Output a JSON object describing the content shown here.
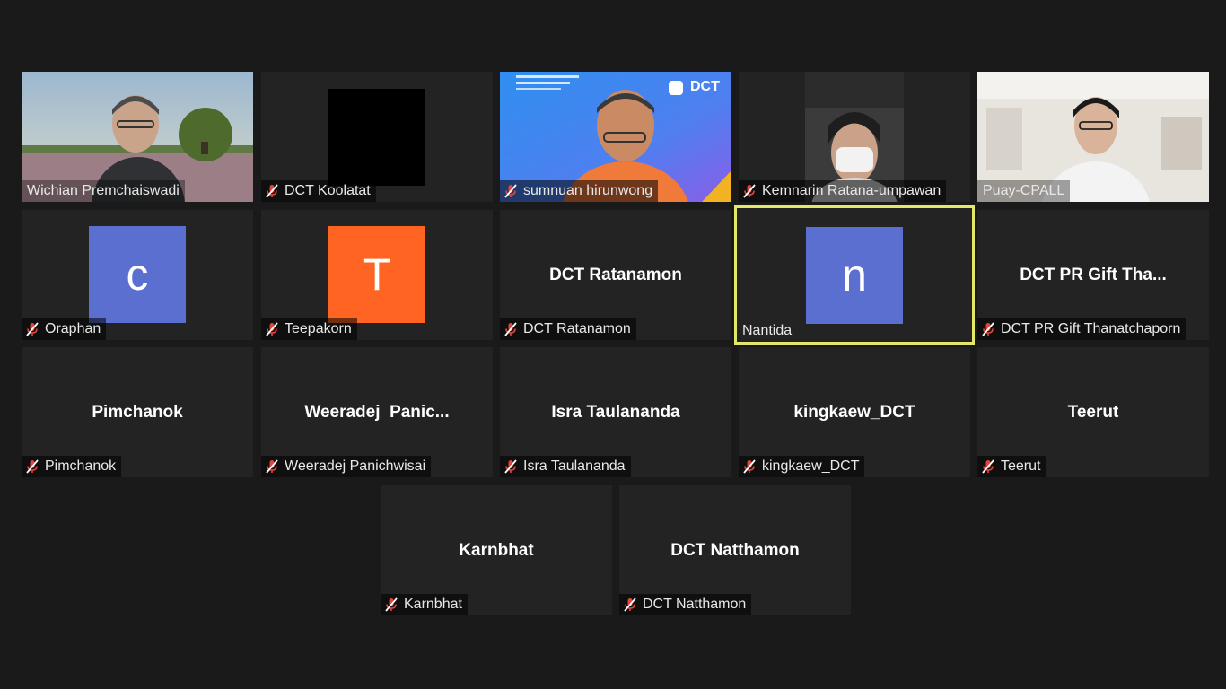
{
  "participants": [
    {
      "label": "Wichian Premchaiswadi",
      "muted": false
    },
    {
      "label": "DCT Koolatat",
      "muted": true
    },
    {
      "label": "sumnuan hirunwong",
      "muted": true,
      "banner_text": "DCT"
    },
    {
      "label": "Kemnarin Ratana-umpawan",
      "muted": true
    },
    {
      "label": "Puay-CPALL",
      "muted": false
    },
    {
      "label": "Oraphan",
      "muted": true,
      "avatar_letter": "c",
      "avatar_color": "#5b6fd0"
    },
    {
      "label": "Teepakorn",
      "muted": true,
      "avatar_letter": "T",
      "avatar_color": "#ff6422"
    },
    {
      "label": "DCT Ratanamon",
      "muted": true,
      "display_name": "DCT Ratanamon"
    },
    {
      "label": "Nantida",
      "muted": false,
      "avatar_letter": "n",
      "avatar_color": "#5b6fd0",
      "speaking": true
    },
    {
      "label": "DCT PR Gift Thanatchaporn",
      "muted": true,
      "display_name": "DCT PR Gift Tha..."
    },
    {
      "label": "Pimchanok",
      "muted": true,
      "display_name": "Pimchanok"
    },
    {
      "label": "Weeradej Panichwisai",
      "muted": true,
      "display_name": "Weeradej  Panic..."
    },
    {
      "label": "Isra Taulananda",
      "muted": true,
      "display_name": "Isra Taulananda"
    },
    {
      "label": "kingkaew_DCT",
      "muted": true,
      "display_name": "kingkaew_DCT"
    },
    {
      "label": "Teerut",
      "muted": true,
      "display_name": "Teerut"
    },
    {
      "label": "Karnbhat",
      "muted": true,
      "display_name": "Karnbhat"
    },
    {
      "label": "DCT Natthamon",
      "muted": true,
      "display_name": "DCT Natthamon"
    }
  ],
  "colors": {
    "background": "#1a1a1a",
    "tile": "#232323",
    "active_border": "#e3e86a",
    "mute_icon": "#e0463b"
  },
  "icons": {
    "mute": "microphone-muted-icon"
  }
}
